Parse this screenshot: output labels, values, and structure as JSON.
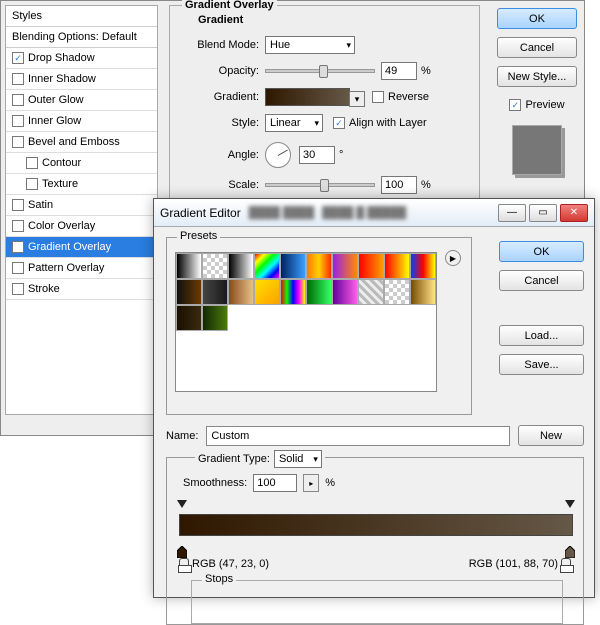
{
  "ls": {
    "styles_title": "Styles",
    "blending_title": "Blending Options: Default",
    "rows": [
      {
        "label": "Drop Shadow",
        "checked": true
      },
      {
        "label": "Inner Shadow",
        "checked": false
      },
      {
        "label": "Outer Glow",
        "checked": false
      },
      {
        "label": "Inner Glow",
        "checked": false
      },
      {
        "label": "Bevel and Emboss",
        "checked": false
      },
      {
        "label": "Contour",
        "checked": false,
        "indent": true
      },
      {
        "label": "Texture",
        "checked": false,
        "indent": true
      },
      {
        "label": "Satin",
        "checked": false
      },
      {
        "label": "Color Overlay",
        "checked": false
      },
      {
        "label": "Gradient Overlay",
        "checked": true,
        "selected": true
      },
      {
        "label": "Pattern Overlay",
        "checked": false
      },
      {
        "label": "Stroke",
        "checked": false
      }
    ],
    "group_title": "Gradient Overlay",
    "group_sub": "Gradient",
    "blend_mode_label": "Blend Mode:",
    "blend_mode_value": "Hue",
    "opacity_label": "Opacity:",
    "opacity_value": "49",
    "opacity_unit": "%",
    "gradient_label": "Gradient:",
    "reverse_label": "Reverse",
    "style_label": "Style:",
    "style_value": "Linear",
    "align_label": "Align with Layer",
    "angle_label": "Angle:",
    "angle_value": "30",
    "angle_unit": "°",
    "scale_label": "Scale:",
    "scale_value": "100",
    "scale_unit": "%",
    "ok": "OK",
    "cancel": "Cancel",
    "newstyle": "New Style...",
    "preview": "Preview"
  },
  "ge": {
    "title": "Gradient Editor",
    "presets_label": "Presets",
    "ok": "OK",
    "cancel": "Cancel",
    "load": "Load...",
    "save": "Save...",
    "name_label": "Name:",
    "name_value": "Custom",
    "new_btn": "New",
    "type_label": "Gradient Type:",
    "type_value": "Solid",
    "smooth_label": "Smoothness:",
    "smooth_value": "100",
    "smooth_unit": "%",
    "rgb_left": "RGB (47, 23, 0)",
    "rgb_right": "RGB (101, 88, 70)",
    "stops_label": "Stops",
    "presets": [
      "linear-gradient(90deg,#000,#fff)",
      "repeating-conic-gradient(#ccc 0 25%,#fff 0 50%) 0/8px 8px",
      "linear-gradient(90deg,#000,#fff)",
      "linear-gradient(135deg,#ff0000,#ffff00,#00ff00,#00ffff,#0000ff,#ff00ff)",
      "linear-gradient(90deg,#002060,#3aa0ff)",
      "linear-gradient(90deg,#ff7a00,#ffd000,#ff2a00)",
      "linear-gradient(90deg,#9b1fe8,#ff8a00)",
      "linear-gradient(90deg,#ff0000,#ff9a00)",
      "linear-gradient(90deg,#ff0000,#ffff00)",
      "linear-gradient(90deg,#0040ff,#ff0000,#ffff00)",
      "linear-gradient(90deg,#101010,#6a3b00)",
      "linear-gradient(90deg,#444,#1a1a1a)",
      "linear-gradient(90deg,#8a4a1a,#e6c08a)",
      "linear-gradient(135deg,#ffe000,#ffa000)",
      "linear-gradient(90deg,#ff0000,#00ff00,#0000ff,#ff00ff,#ffff00)",
      "linear-gradient(90deg,#006a00,#33ff66)",
      "linear-gradient(90deg,#61009e,#ff5ee6)",
      "repeating-linear-gradient(45deg,#bbb 0 3px,#eee 3px 6px)",
      "repeating-conic-gradient(#ccc 0 25%,#fff 0 50%) 0/8px 8px",
      "linear-gradient(90deg,#7a4a00,#ffe48a)",
      "linear-gradient(90deg,#1a1000,#3a2a10)",
      "linear-gradient(90deg,#132800,#4a7a10)"
    ]
  }
}
